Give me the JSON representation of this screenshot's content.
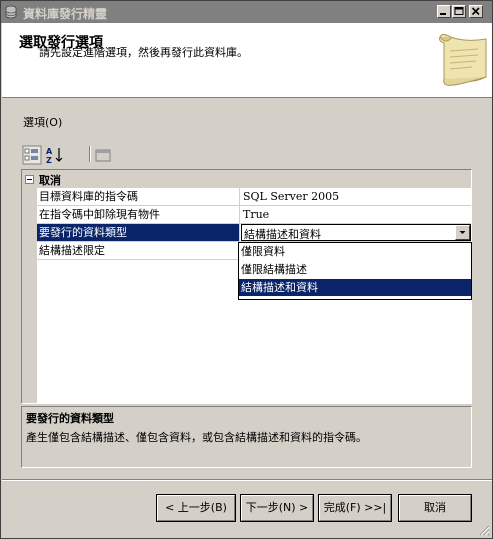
{
  "window": {
    "title": "資料庫發行精靈",
    "minimize_label": "minimize-icon",
    "maximize_label": "maximize-icon",
    "close_label": "close-icon"
  },
  "header": {
    "title": "選取發行選項",
    "subtitle": "請先設定進階選項，然後再發行此資料庫。"
  },
  "options": {
    "label": "選項(O)"
  },
  "grid": {
    "category": "取消",
    "properties": [
      {
        "name": "目標資料庫的指令碼",
        "value": "SQL Server 2005"
      },
      {
        "name": "在指令碼中卸除現有物件",
        "value": "True"
      },
      {
        "name": "要發行的資料類型",
        "value": "結構描述和資料"
      },
      {
        "name": "結構描述限定",
        "value": ""
      }
    ],
    "dropdown_options": [
      "僅限資料",
      "僅限結構描述",
      "結構描述和資料"
    ],
    "dropdown_selected_index": 2
  },
  "description": {
    "title": "要發行的資料類型",
    "text": "產生僅包含結構描述、僅包含資料，或包含結構描述和資料的指令碼。"
  },
  "buttons": {
    "back": "< 上一步(B)",
    "next": "下一步(N) >",
    "finish": "完成(F) >>|",
    "cancel": "取消"
  },
  "colors": {
    "selection": "#0a246a",
    "face": "#d4d0c8",
    "titlebar_inactive": "#808080"
  }
}
